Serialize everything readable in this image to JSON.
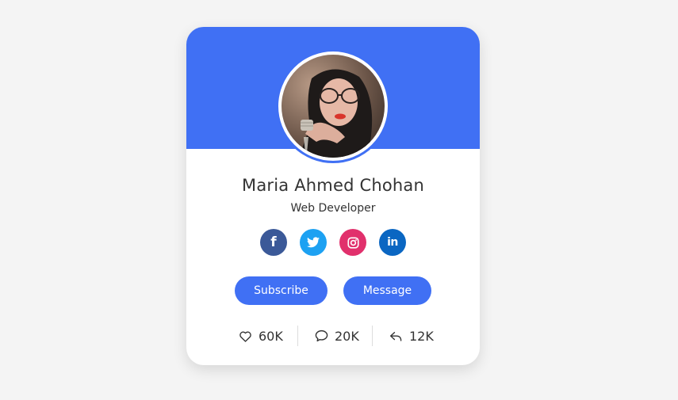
{
  "profile": {
    "name": "Maria Ahmed Chohan",
    "job": "Web Developer"
  },
  "socials": [
    {
      "icon": "facebook-icon",
      "glyph": "f",
      "color": "#3b5998"
    },
    {
      "icon": "twitter-icon",
      "color": "#1da1f2"
    },
    {
      "icon": "instagram-icon",
      "color": "#e1306c"
    },
    {
      "icon": "linkedin-icon",
      "glyph": "in",
      "color": "#0a66c2"
    }
  ],
  "buttons": {
    "subscribe": "Subscribe",
    "message": "Message"
  },
  "stats": {
    "likes": "60K",
    "comments": "20K",
    "shares": "12K"
  },
  "colors": {
    "accent": "#4070f4",
    "background": "#f4f4f4",
    "card": "#ffffff",
    "text": "#333333"
  }
}
